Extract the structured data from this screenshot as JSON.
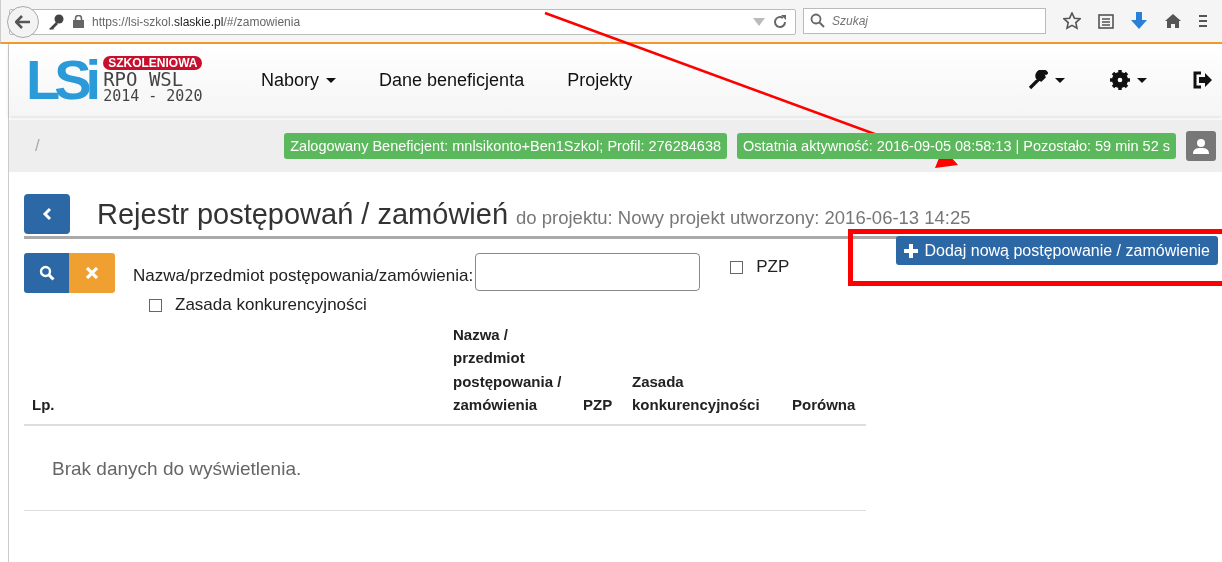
{
  "browser": {
    "url": "https://lsi-szkol.**slaskie.pl**/#/zamowienia",
    "search": {
      "placeholder": "Szukaj"
    }
  },
  "logo": {
    "mark": "LSi",
    "badge": "SZKOLENIOWA",
    "line1": "RPO WSL",
    "line2": "2014 - 2020"
  },
  "nav": {
    "items": [
      {
        "label": "Nabory",
        "dropdown": true
      },
      {
        "label": "Dane beneficjenta",
        "dropdown": false
      },
      {
        "label": "Projekty",
        "dropdown": false
      }
    ]
  },
  "status_bar": {
    "breadcrumb": "/",
    "badges": [
      "Zalogowany Beneficjent: mnlsikonto+Ben1Szkol; Profil: 276284638",
      "Ostatnia aktywność: 2016-09-05 08:58:13 | Pozostało: 59 min 52 s"
    ]
  },
  "page": {
    "title": "Rejestr postępowań / zamówień",
    "subtitle": "do projektu: Nowy projekt utworzony: 2016-06-13 14:25",
    "add_button": "Dodaj nową postępowanie / zamówienie"
  },
  "filter": {
    "label": "Nazwa/przedmiot postępowania/zamówienia:",
    "checkboxes": [
      {
        "label": "PZP",
        "checked": false
      },
      {
        "label": "Zasada konkurencyjności",
        "checked": false
      }
    ]
  },
  "table": {
    "columns": [
      "Lp.",
      "Nazwa / przedmiot postępowania / zamówienia",
      "PZP",
      "Zasada konkurencyjności",
      "Porówna"
    ],
    "empty_message": "Brak danych do wyświetlenia."
  }
}
